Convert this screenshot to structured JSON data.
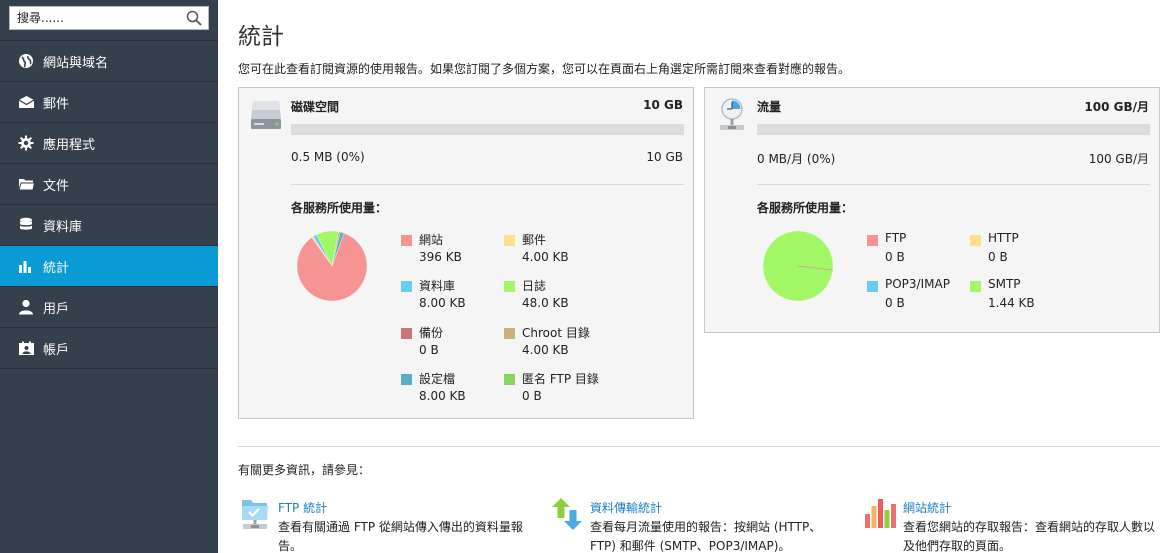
{
  "sidebar": {
    "search_placeholder": "搜尋......",
    "items": [
      {
        "label": "網站與域名",
        "icon": "globe-icon"
      },
      {
        "label": "郵件",
        "icon": "mail-icon"
      },
      {
        "label": "應用程式",
        "icon": "gear-icon"
      },
      {
        "label": "文件",
        "icon": "folder-icon"
      },
      {
        "label": "資料庫",
        "icon": "database-icon"
      },
      {
        "label": "統計",
        "icon": "bar-chart-icon",
        "active": true
      },
      {
        "label": "用戶",
        "icon": "user-icon"
      },
      {
        "label": "帳戶",
        "icon": "account-icon"
      }
    ]
  },
  "page": {
    "title": "統計",
    "intro": "您可在此查看訂閱資源的使用報告。如果您訂閱了多個方案，您可以在頁面右上角選定所需訂閱來查看對應的報告。"
  },
  "disk": {
    "title": "磁碟空間",
    "total": "10 GB",
    "used": "0.5 MB (0%)",
    "quota": "10 GB",
    "percent_used": 0,
    "services_label": "各服務所使用量：",
    "legend": [
      {
        "name": "網站",
        "value": "396 KB",
        "color": "#f59492"
      },
      {
        "name": "郵件",
        "value": "4.00 KB",
        "color": "#fde08a"
      },
      {
        "name": "資料庫",
        "value": "8.00 KB",
        "color": "#67cef3"
      },
      {
        "name": "日誌",
        "value": "48.0 KB",
        "color": "#a2f765"
      },
      {
        "name": "備份",
        "value": "0 B",
        "color": "#c97676"
      },
      {
        "name": "Chroot 目錄",
        "value": "4.00 KB",
        "color": "#c9b17e"
      },
      {
        "name": "設定檔",
        "value": "8.00 KB",
        "color": "#5baecb"
      },
      {
        "name": "匿名 FTP 目錄",
        "value": "0 B",
        "color": "#86d65a"
      }
    ]
  },
  "traffic": {
    "title": "流量",
    "total": "100 GB/月",
    "used": "0 MB/月 (0%)",
    "quota": "100 GB/月",
    "percent_used": 0,
    "services_label": "各服務所使用量：",
    "legend": [
      {
        "name": "FTP",
        "value": "0 B",
        "color": "#f59492"
      },
      {
        "name": "HTTP",
        "value": "0 B",
        "color": "#fde08a"
      },
      {
        "name": "POP3/IMAP",
        "value": "0 B",
        "color": "#67cef3"
      },
      {
        "name": "SMTP",
        "value": "1.44 KB",
        "color": "#a2f765"
      }
    ]
  },
  "chart_data": [
    {
      "type": "pie",
      "categories": [
        "網站",
        "郵件",
        "資料庫",
        "日誌",
        "備份",
        "Chroot 目錄",
        "設定檔",
        "匿名 FTP 目錄"
      ],
      "values": [
        396,
        4,
        8,
        48,
        0,
        4,
        8,
        0
      ],
      "colors": [
        "#f59492",
        "#fde08a",
        "#67cef3",
        "#a2f765",
        "#c97676",
        "#c9b17e",
        "#5baecb",
        "#86d65a"
      ]
    },
    {
      "type": "pie",
      "categories": [
        "FTP",
        "HTTP",
        "POP3/IMAP",
        "SMTP"
      ],
      "values": [
        0,
        0,
        0,
        1.44
      ],
      "colors": [
        "#f59492",
        "#fde08a",
        "#67cef3",
        "#a2f765"
      ]
    }
  ],
  "more": {
    "label": "有關更多資訊，請參見：",
    "items": [
      {
        "link": "FTP 統計",
        "desc": "查看有關通過 FTP 從網站傳入傳出的資料量報告。"
      },
      {
        "link": "資料傳輸統計",
        "desc": "查看每月流量使用的報告：按網站 (HTTP、FTP) 和郵件 (SMTP、POP3/IMAP)。"
      },
      {
        "link": "網站統計",
        "desc": "查看您網站的存取報告：查看網站的存取人數以及他們存取的頁面。"
      }
    ]
  }
}
